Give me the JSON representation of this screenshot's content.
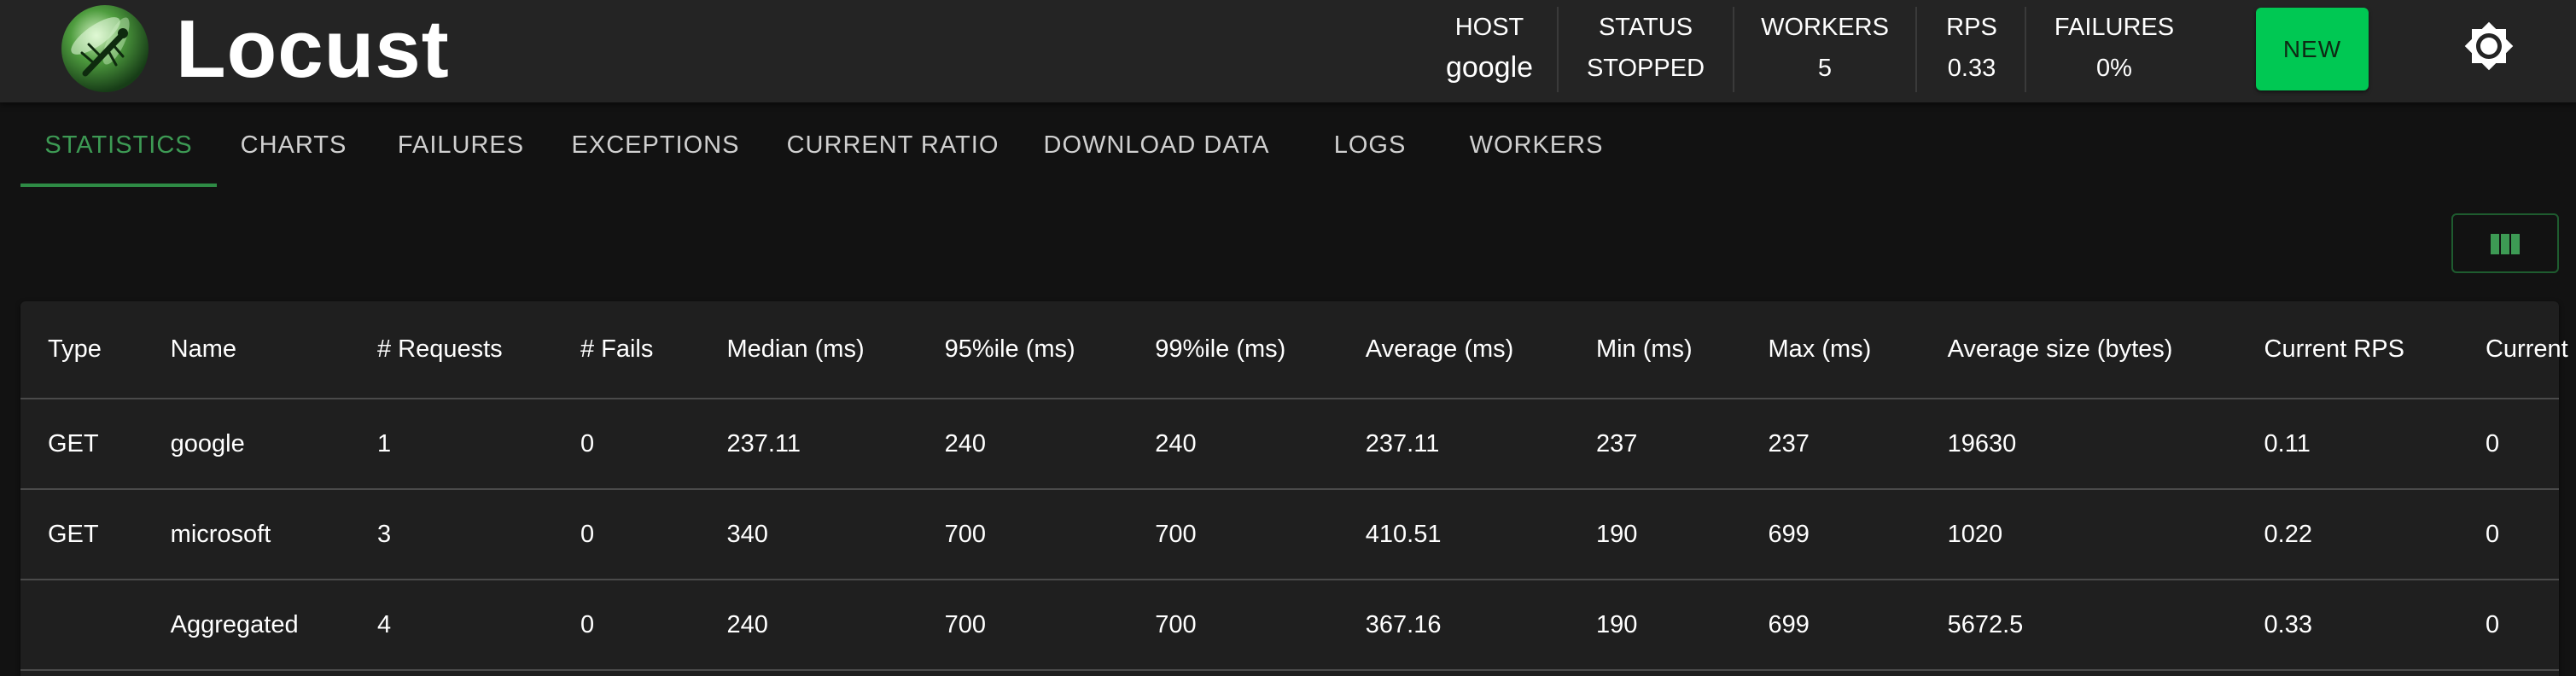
{
  "app": {
    "title": "Locust",
    "accent_color": "#00c853",
    "logo_icon": "locust-logo-icon"
  },
  "header": {
    "stats": [
      {
        "label": "HOST",
        "value": "google"
      },
      {
        "label": "STATUS",
        "value": "STOPPED"
      },
      {
        "label": "WORKERS",
        "value": "5"
      },
      {
        "label": "RPS",
        "value": "0.33"
      },
      {
        "label": "FAILURES",
        "value": "0%"
      }
    ],
    "new_button_label": "NEW",
    "theme_toggle_icon": "brightness-icon"
  },
  "tabs": [
    {
      "label": "STATISTICS",
      "active": true
    },
    {
      "label": "CHARTS",
      "active": false
    },
    {
      "label": "FAILURES",
      "active": false
    },
    {
      "label": "EXCEPTIONS",
      "active": false
    },
    {
      "label": "CURRENT RATIO",
      "active": false
    },
    {
      "label": "DOWNLOAD DATA",
      "active": false
    },
    {
      "label": "LOGS",
      "active": false
    },
    {
      "label": "WORKERS",
      "active": false
    }
  ],
  "toolbar": {
    "columns_icon": "view-columns-icon"
  },
  "stats_table": {
    "columns": [
      "Type",
      "Name",
      "# Requests",
      "# Fails",
      "Median (ms)",
      "95%ile (ms)",
      "99%ile (ms)",
      "Average (ms)",
      "Min (ms)",
      "Max (ms)",
      "Average size (bytes)",
      "Current RPS",
      "Current Failures/s"
    ],
    "rows": [
      [
        "GET",
        "google",
        "1",
        "0",
        "237.11",
        "240",
        "240",
        "237.11",
        "237",
        "237",
        "19630",
        "0.11",
        "0"
      ],
      [
        "GET",
        "microsoft",
        "3",
        "0",
        "340",
        "700",
        "700",
        "410.51",
        "190",
        "699",
        "1020",
        "0.22",
        "0"
      ],
      [
        "",
        "Aggregated",
        "4",
        "0",
        "240",
        "700",
        "700",
        "367.16",
        "190",
        "699",
        "5672.5",
        "0.33",
        "0"
      ]
    ]
  }
}
